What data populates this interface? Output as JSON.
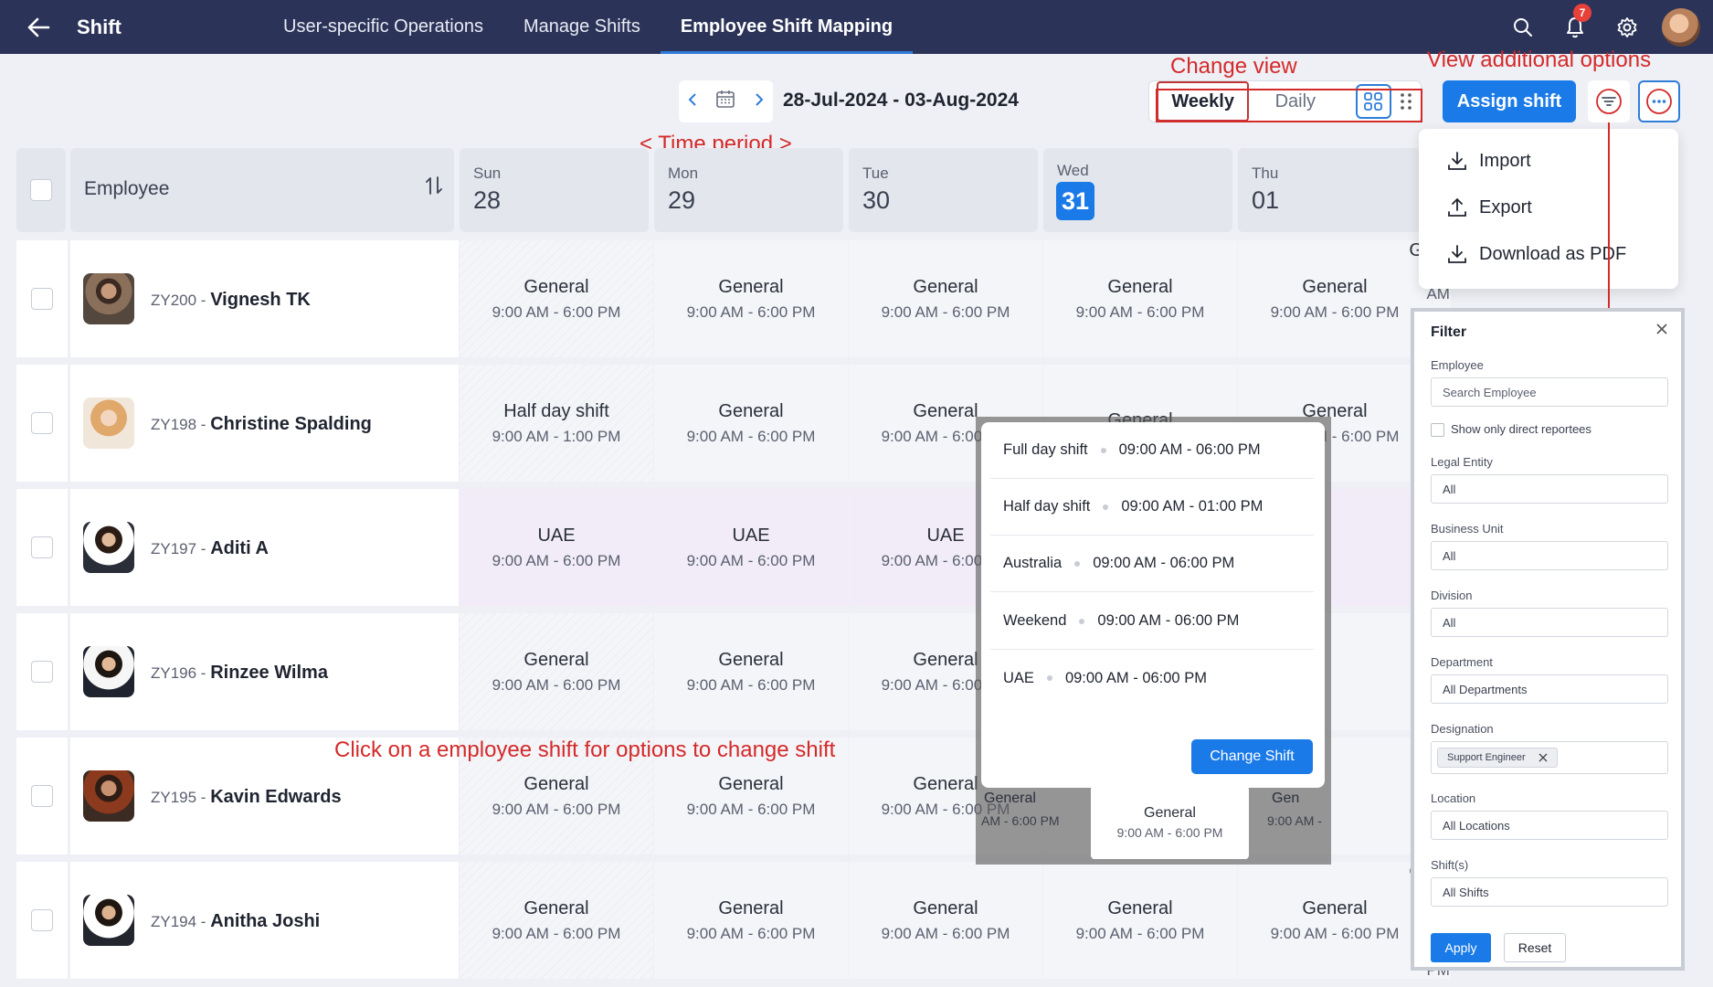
{
  "topbar": {
    "app_title": "Shift",
    "tabs": [
      "User-specific Operations",
      "Manage Shifts",
      "Employee Shift Mapping"
    ],
    "notification_count": "7"
  },
  "toolbar": {
    "date_range": "28-Jul-2024 - 03-Aug-2024",
    "view_weekly": "Weekly",
    "view_daily": "Daily",
    "assign_label": "Assign shift"
  },
  "annotations": {
    "change_view": "Change view",
    "additional_options": "View additional options",
    "time_period": "<  Time period >",
    "click_shift": "Click on a employee shift for options to change shift"
  },
  "grid": {
    "employee_header": "Employee",
    "days": [
      {
        "name": "Sun",
        "num": "28"
      },
      {
        "name": "Mon",
        "num": "29"
      },
      {
        "name": "Tue",
        "num": "30"
      },
      {
        "name": "Wed",
        "num": "31"
      },
      {
        "name": "Thu",
        "num": "01"
      }
    ],
    "rows": [
      {
        "code": "ZY200 - ",
        "name": "Vignesh TK",
        "shifts": [
          [
            "General",
            "9:00 AM - 6:00 PM"
          ],
          [
            "General",
            "9:00 AM - 6:00 PM"
          ],
          [
            "General",
            "9:00 AM - 6:00 PM"
          ],
          [
            "General",
            "9:00 AM - 6:00 PM"
          ],
          [
            "General",
            "9:00 AM - 6:00 PM"
          ],
          [
            "General",
            "9:00 AM - 6:00 PM"
          ]
        ]
      },
      {
        "code": "ZY198 - ",
        "name": "Christine Spalding",
        "shifts": [
          [
            "Half day shift",
            "9:00 AM - 1:00 PM"
          ],
          [
            "General",
            "9:00 AM - 6:00 PM"
          ],
          [
            "General",
            "9:00 AM - 6:00 PM"
          ],
          [
            "General",
            ""
          ],
          [
            "General",
            "9:00 AM - 6:00 PM"
          ],
          [
            "",
            "6:00 PM"
          ]
        ]
      },
      {
        "code": "ZY197 - ",
        "name": "Aditi A",
        "shifts": [
          [
            "UAE",
            "9:00 AM - 6:00 PM"
          ],
          [
            "UAE",
            "9:00 AM - 6:00 PM"
          ],
          [
            "UAE",
            "9:00 AM - 6:00 PM"
          ],
          [
            "",
            ""
          ],
          [
            "",
            ""
          ],
          [
            "AE",
            "6:00 PM"
          ]
        ]
      },
      {
        "code": "ZY196 - ",
        "name": "Rinzee Wilma",
        "shifts": [
          [
            "General",
            "9:00 AM - 6:00 PM"
          ],
          [
            "General",
            "9:00 AM - 6:00 PM"
          ],
          [
            "General",
            "9:00 AM - 6:00 PM"
          ],
          [
            "",
            ""
          ],
          [
            "",
            ""
          ],
          [
            "eral",
            "6:00 PM"
          ]
        ]
      },
      {
        "code": "ZY195 - ",
        "name": "Kavin Edwards",
        "shifts": [
          [
            "General",
            "9:00 AM - 6:00 PM"
          ],
          [
            "General",
            "9:00 AM - 6:00 PM"
          ],
          [
            "General",
            "9:00 AM - 6:00 PM"
          ],
          [
            "",
            ""
          ],
          [
            "",
            ""
          ],
          [
            "eral",
            "6:00 PM"
          ]
        ]
      },
      {
        "code": "ZY194 - ",
        "name": "Anitha Joshi",
        "shifts": [
          [
            "General",
            "9:00 AM - 6:00 PM"
          ],
          [
            "General",
            "9:00 AM - 6:00 PM"
          ],
          [
            "General",
            "9:00 AM - 6:00 PM"
          ],
          [
            "General",
            "9:00 AM - 6:00 PM"
          ],
          [
            "General",
            "9:00 AM - 6:00 PM"
          ],
          [
            "General",
            "9:00 AM - 6:00 PM"
          ]
        ]
      }
    ]
  },
  "more_menu": {
    "import": "Import",
    "export": "Export",
    "download_pdf": "Download as PDF"
  },
  "filter": {
    "title": "Filter",
    "employee_label": "Employee",
    "employee_placeholder": "Search Employee",
    "direct_reportees": "Show only direct reportees",
    "legal_entity_label": "Legal Entity",
    "legal_entity_value": "All",
    "business_unit_label": "Business Unit",
    "business_unit_value": "All",
    "division_label": "Division",
    "division_value": "All",
    "department_label": "Department",
    "department_value": "All Departments",
    "designation_label": "Designation",
    "designation_chip": "Support Engineer",
    "location_label": "Location",
    "location_value": "All Locations",
    "shifts_label": "Shift(s)",
    "shifts_value": "All Shifts",
    "apply": "Apply",
    "reset": "Reset"
  },
  "shift_popup": {
    "options": [
      {
        "name": "Full day shift",
        "time": "09:00 AM - 06:00 PM"
      },
      {
        "name": "Half day shift",
        "time": "09:00 AM - 01:00 PM"
      },
      {
        "name": "Australia",
        "time": "09:00 AM - 06:00 PM"
      },
      {
        "name": "Weekend",
        "time": "09:00 AM - 06:00 PM"
      },
      {
        "name": "UAE",
        "time": "09:00 AM - 06:00 PM"
      }
    ],
    "change_label": "Change Shift",
    "preview_name": "General",
    "preview_time": "9:00 AM - 6:00 PM",
    "left_name": "General",
    "left_time": "AM - 6:00 PM",
    "right_name": "Gen",
    "right_time": "9:00 AM -"
  },
  "colors": {
    "topbar": "#2b3458",
    "accent": "#1a7ae8",
    "annotation": "#d42a2a",
    "uae_row": "#f1ecf8"
  }
}
